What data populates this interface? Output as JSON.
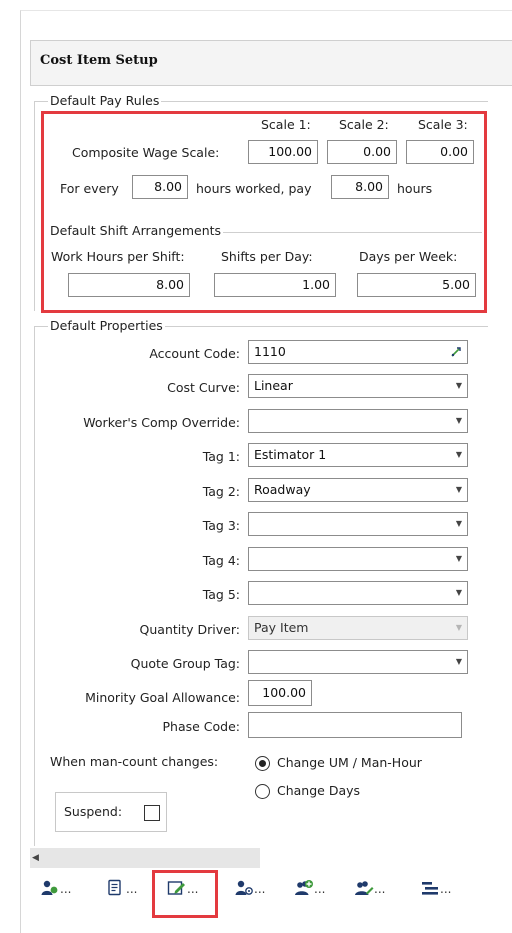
{
  "header": {
    "title": "Cost Item Setup"
  },
  "pay_rules": {
    "group_label": "Default Pay Rules",
    "scale_headers": [
      "Scale 1:",
      "Scale 2:",
      "Scale 3:"
    ],
    "composite_label": "Composite Wage Scale:",
    "scale_values": [
      "100.00",
      "0.00",
      "0.00"
    ],
    "for_every_label": "For every",
    "for_every_value": "8.00",
    "hours_worked_label": "hours worked, pay",
    "pay_value": "8.00",
    "hours_label": "hours"
  },
  "shift": {
    "group_label": "Default Shift Arrangements",
    "labels": [
      "Work Hours per Shift:",
      "Shifts per Day:",
      "Days per Week:"
    ],
    "values": [
      "8.00",
      "1.00",
      "5.00"
    ]
  },
  "properties": {
    "group_label": "Default Properties",
    "account_code_label": "Account Code:",
    "account_code_value": "1110",
    "cost_curve_label": "Cost Curve:",
    "cost_curve_value": "Linear",
    "workers_comp_label": "Worker's Comp Override:",
    "workers_comp_value": "",
    "tag1_label": "Tag 1:",
    "tag1_value": "Estimator 1",
    "tag2_label": "Tag 2:",
    "tag2_value": "Roadway",
    "tag3_label": "Tag 3:",
    "tag3_value": "",
    "tag4_label": "Tag 4:",
    "tag4_value": "",
    "tag5_label": "Tag 5:",
    "tag5_value": "",
    "quantity_driver_label": "Quantity Driver:",
    "quantity_driver_value": "Pay Item",
    "quote_group_label": "Quote Group Tag:",
    "quote_group_value": "",
    "minority_label": "Minority Goal Allowance:",
    "minority_value": "100.00",
    "phase_code_label": "Phase Code:",
    "phase_code_value": "",
    "man_count_label": "When man-count changes:",
    "radio_options": [
      "Change UM / Man-Hour",
      "Change Days"
    ],
    "radio_selected": "Change UM / Man-Hour",
    "suspend_label": "Suspend:",
    "suspend_checked": false
  },
  "toolbar": {
    "dots": [
      "...",
      "...",
      "...",
      "...",
      "...",
      "...",
      "..."
    ]
  },
  "colors": {
    "highlight": "#e33a3f",
    "icon_green": "#3f9a3c",
    "icon_navy": "#1f3a6b"
  }
}
